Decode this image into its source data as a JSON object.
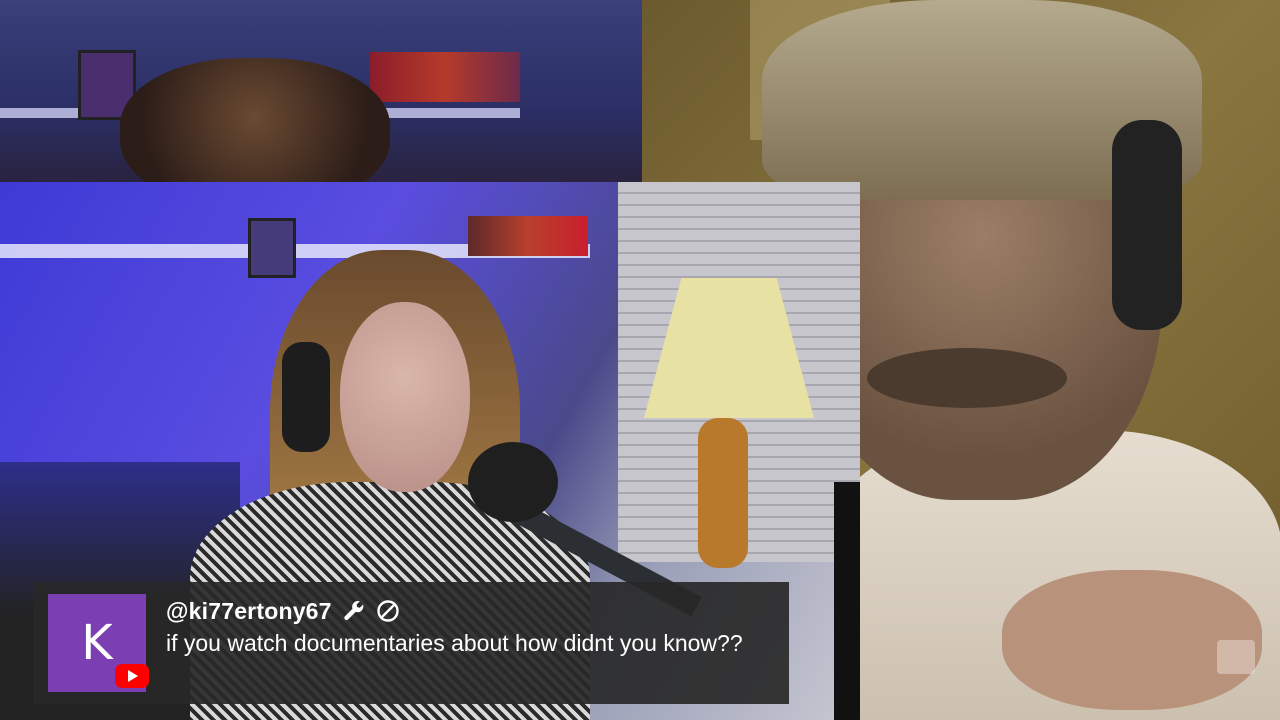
{
  "feeds": {
    "top_left": "video-feed-guest-top",
    "main": "video-feed-host-woman",
    "right": "video-feed-guest-man"
  },
  "chat": {
    "avatar_letter": "K",
    "avatar_color": "#7b3fb3",
    "username": "@ki77ertony67",
    "badges": [
      "wrench-icon",
      "blocked-icon"
    ],
    "message": "if you watch documentaries about how didnt you know??",
    "platform_icon": "youtube-icon",
    "platform_color": "#ff0000"
  }
}
